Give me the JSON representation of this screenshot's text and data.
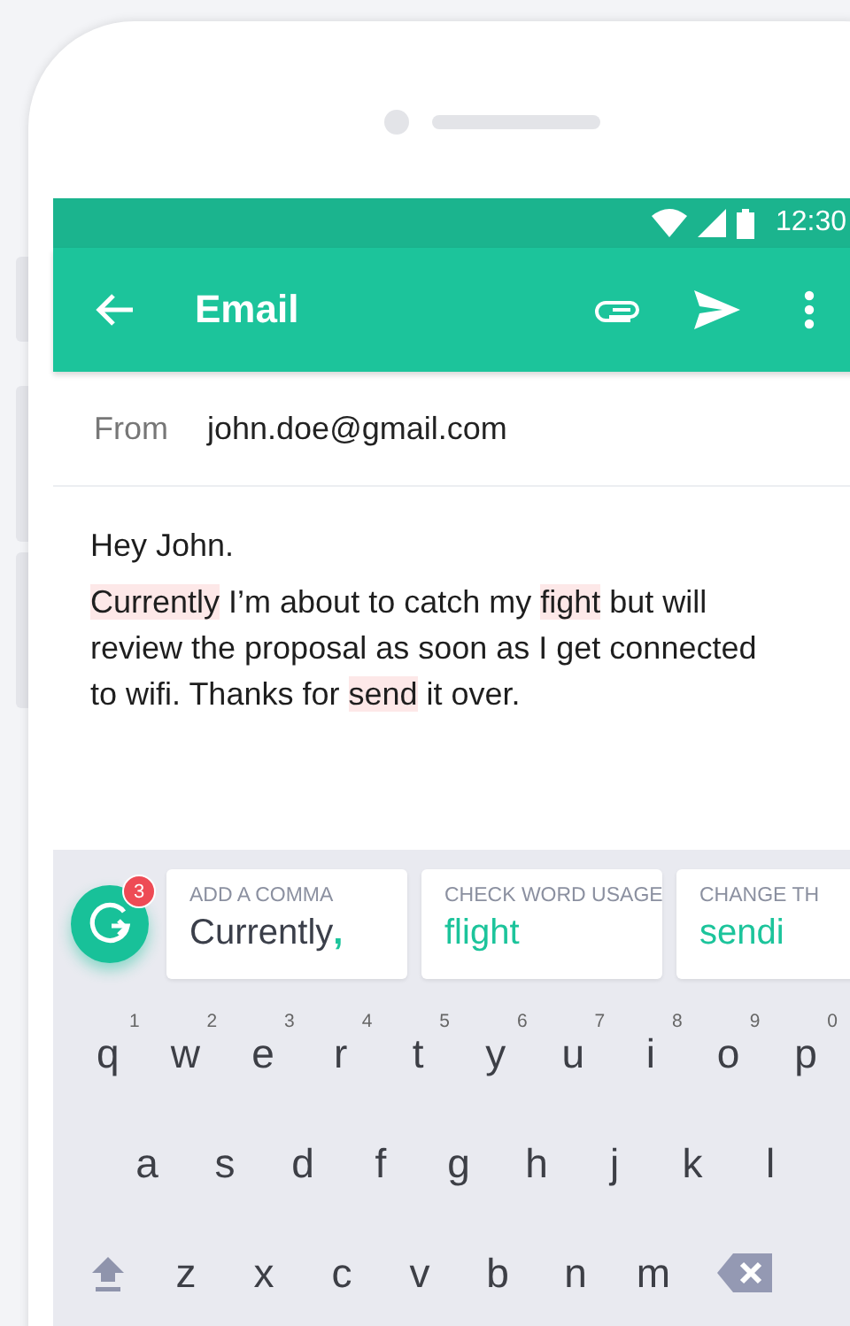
{
  "status_bar": {
    "time": "12:30"
  },
  "toolbar": {
    "title": "Email"
  },
  "from": {
    "label": "From",
    "value": "john.doe@gmail.com"
  },
  "body": {
    "greeting": "Hey John.",
    "segments": [
      {
        "text": "Currently",
        "flagged": true
      },
      {
        "text": " I’m about to catch my ",
        "flagged": false
      },
      {
        "text": "fight",
        "flagged": true
      },
      {
        "text": " but will review the proposal as soon as I get connected to wifi. Thanks for ",
        "flagged": false
      },
      {
        "text": "send",
        "flagged": true
      },
      {
        "text": " it over.",
        "flagged": false
      }
    ]
  },
  "assistant": {
    "badge": "3"
  },
  "suggestions": [
    {
      "label": "ADD A COMMA",
      "text": "Currently",
      "insertion": ","
    },
    {
      "label": "CHECK WORD USAGE",
      "text": "flight"
    },
    {
      "label": "CHANGE TH",
      "text": "sendi"
    }
  ],
  "keyboard": {
    "rows": [
      [
        {
          "kind": "letter",
          "label": "q",
          "hint": "1"
        },
        {
          "kind": "letter",
          "label": "w",
          "hint": "2"
        },
        {
          "kind": "letter",
          "label": "e",
          "hint": "3"
        },
        {
          "kind": "letter",
          "label": "r",
          "hint": "4"
        },
        {
          "kind": "letter",
          "label": "t",
          "hint": "5"
        },
        {
          "kind": "letter",
          "label": "y",
          "hint": "6"
        },
        {
          "kind": "letter",
          "label": "u",
          "hint": "7"
        },
        {
          "kind": "letter",
          "label": "i",
          "hint": "8"
        },
        {
          "kind": "letter",
          "label": "o",
          "hint": "9"
        },
        {
          "kind": "letter",
          "label": "p",
          "hint": "0"
        }
      ],
      [
        {
          "kind": "letter",
          "label": "a"
        },
        {
          "kind": "letter",
          "label": "s"
        },
        {
          "kind": "letter",
          "label": "d"
        },
        {
          "kind": "letter",
          "label": "f"
        },
        {
          "kind": "letter",
          "label": "g"
        },
        {
          "kind": "letter",
          "label": "h"
        },
        {
          "kind": "letter",
          "label": "j"
        },
        {
          "kind": "letter",
          "label": "k"
        },
        {
          "kind": "letter",
          "label": "l"
        }
      ],
      [
        {
          "kind": "shift"
        },
        {
          "kind": "letter",
          "label": "z"
        },
        {
          "kind": "letter",
          "label": "x"
        },
        {
          "kind": "letter",
          "label": "c"
        },
        {
          "kind": "letter",
          "label": "v"
        },
        {
          "kind": "letter",
          "label": "b"
        },
        {
          "kind": "letter",
          "label": "n"
        },
        {
          "kind": "letter",
          "label": "m"
        },
        {
          "kind": "backspace"
        }
      ]
    ]
  }
}
